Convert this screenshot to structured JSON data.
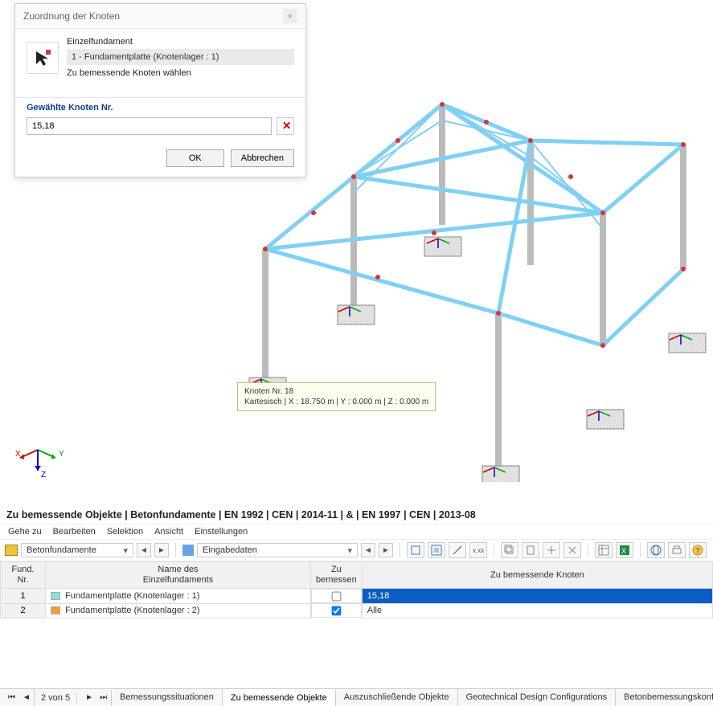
{
  "dialog": {
    "title": "Zuordnung der Knoten",
    "single_label": "Einzelfundament",
    "combo_value": "1 - Fundamentplatte (Knotenlager : 1)",
    "hint": "Zu bemessende Knoten wählen",
    "section": "Gewählte Knoten Nr.",
    "value": "15,18",
    "ok": "OK",
    "cancel": "Abbrechen"
  },
  "tooltip3d": {
    "l1": "Knoten Nr. 18",
    "l2": "Kartesisch | X : 18.750 m | Y : 0.000 m | Z : 0.000 m"
  },
  "axes": {
    "x": "X",
    "y": "Y",
    "z": "Z"
  },
  "panel": {
    "title": "Zu bemessende Objekte | Betonfundamente | EN 1992 | CEN | 2014-11 | & | EN 1997 | CEN | 2013-08",
    "menu": {
      "goto": "Gehe zu",
      "edit": "Bearbeiten",
      "selection": "Selektion",
      "view": "Ansicht",
      "settings": "Einstellungen"
    },
    "dd1": "Betonfundamente",
    "dd2": "Eingabedaten"
  },
  "table": {
    "headers": {
      "num": "Fund.\nNr.",
      "name": "Name des\nEinzelfundaments",
      "design": "Zu\nbemessen",
      "nodes": "Zu bemessende Knoten"
    },
    "rows": [
      {
        "num": "1",
        "name": "Fundamentplatte (Knotenlager : 1)",
        "design": false,
        "nodes": "15,18",
        "swatch": "#8ee0d0",
        "selected": true
      },
      {
        "num": "2",
        "name": "Fundamentplatte (Knotenlager : 2)",
        "design": true,
        "nodes": "Alle",
        "swatch": "#f0a030",
        "selected": false
      }
    ]
  },
  "tabs": {
    "pager": "2 von 5",
    "items": [
      "Bemessungssituationen",
      "Zu bemessende Objekte",
      "Auszuschließende Objekte",
      "Geotechnical Design Configurations",
      "Betonbemessungskonfigurationen"
    ],
    "active": 1
  }
}
